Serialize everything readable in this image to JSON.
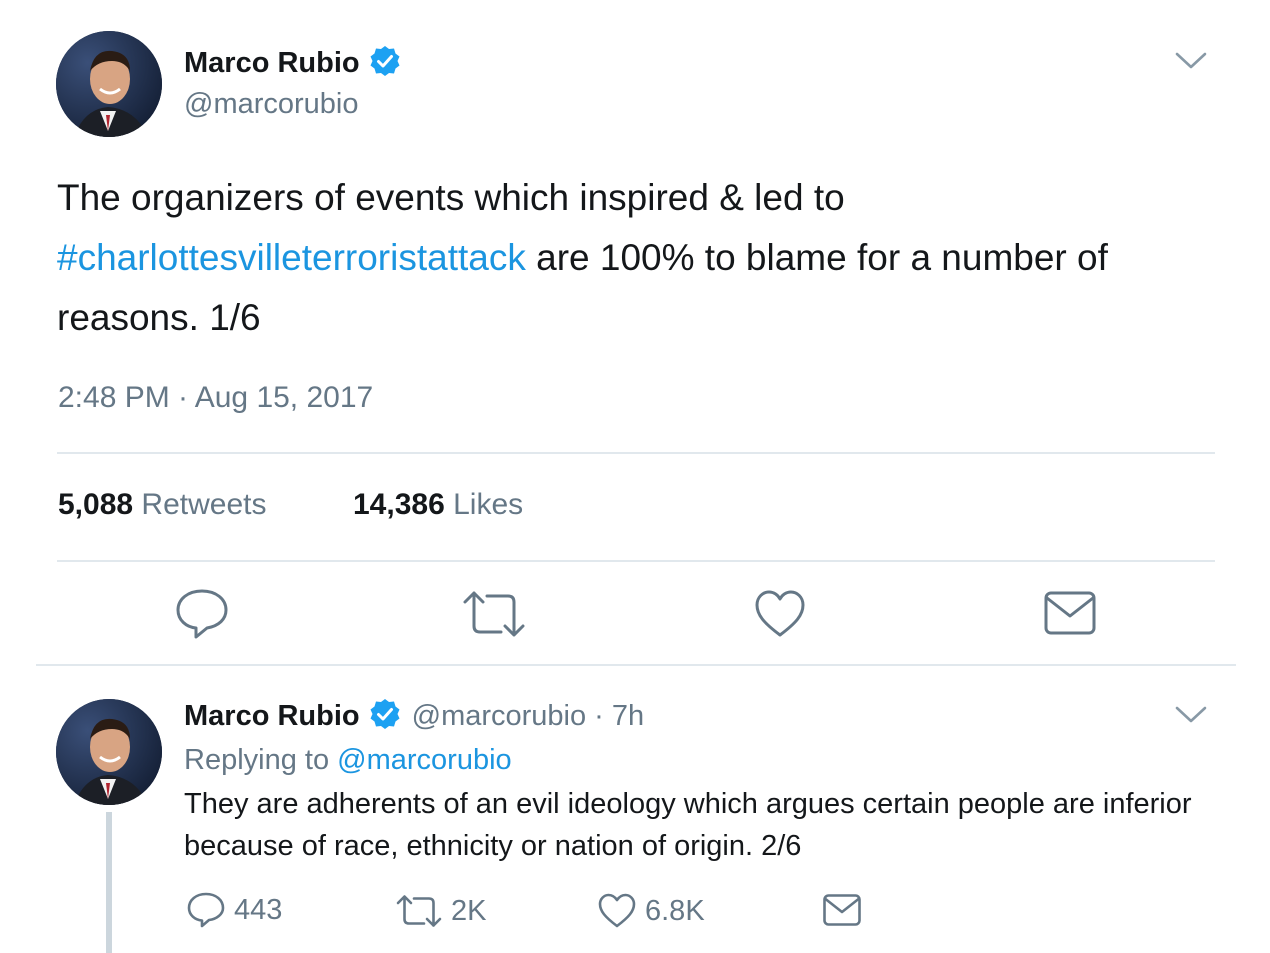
{
  "main_tweet": {
    "author_name": "Marco Rubio",
    "author_handle": "@marcorubio",
    "text_before": "The organizers of events which inspired & led to",
    "hashtag": "#charlottesvilleterroristattack",
    "text_after": " are 100% to blame for a number of reasons. 1/6",
    "timestamp": "2:48 PM · Aug 15, 2017",
    "retweet_count": "5,088",
    "retweet_label": "Retweets",
    "like_count": "14,386",
    "like_label": "Likes"
  },
  "reply_tweet": {
    "author_name": "Marco Rubio",
    "author_handle": "@marcorubio",
    "time_ago": "· 7h",
    "replying_prefix": "Replying to",
    "replying_to": "@marcorubio",
    "text": "They are adherents of an evil ideology which argues certain people are inferior because of race, ethnicity or nation of origin. 2/6",
    "reply_count": "443",
    "retweet_count": "2K",
    "like_count": "6.8K"
  },
  "icons": {
    "verified": "verified-badge-icon",
    "menu": "chevron-down-icon",
    "reply": "reply-icon",
    "retweet": "retweet-icon",
    "like": "heart-icon",
    "share": "envelope-icon"
  },
  "colors": {
    "link": "#1b95e0",
    "secondary_text": "#657786",
    "divider": "#e1e8ed",
    "verified": "#1da1f2"
  }
}
